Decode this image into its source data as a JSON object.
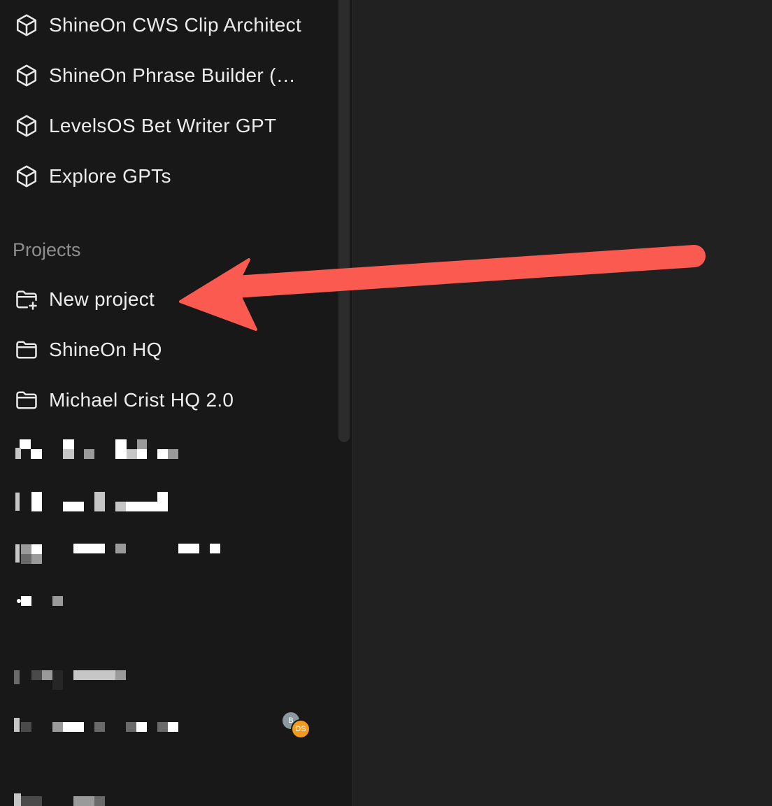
{
  "gpts": [
    {
      "label": "ShineOn CWS Clip Architect",
      "icon": "gpt-cube-icon"
    },
    {
      "label": "ShineOn Phrase Builder (O...",
      "icon": "gpt-cube-icon"
    },
    {
      "label": "LevelsOS Bet Writer GPT",
      "icon": "gpt-cube-icon"
    },
    {
      "label": "Explore GPTs",
      "icon": "gpt-cube-icon"
    }
  ],
  "projects": {
    "title": "Projects",
    "items": [
      {
        "label": "New project",
        "icon": "folder-plus-icon"
      },
      {
        "label": "ShineOn HQ",
        "icon": "folder-icon"
      },
      {
        "label": "Michael Crist HQ 2.0",
        "icon": "folder-icon"
      }
    ]
  },
  "avatars": {
    "back_initial": "B",
    "front_initials": "DS",
    "front_color": "#f29a1e",
    "back_color": "#8a9aa0"
  },
  "colors": {
    "arrow": "#fa5a4f",
    "sidebar_bg": "#181818",
    "main_bg": "#212121"
  }
}
